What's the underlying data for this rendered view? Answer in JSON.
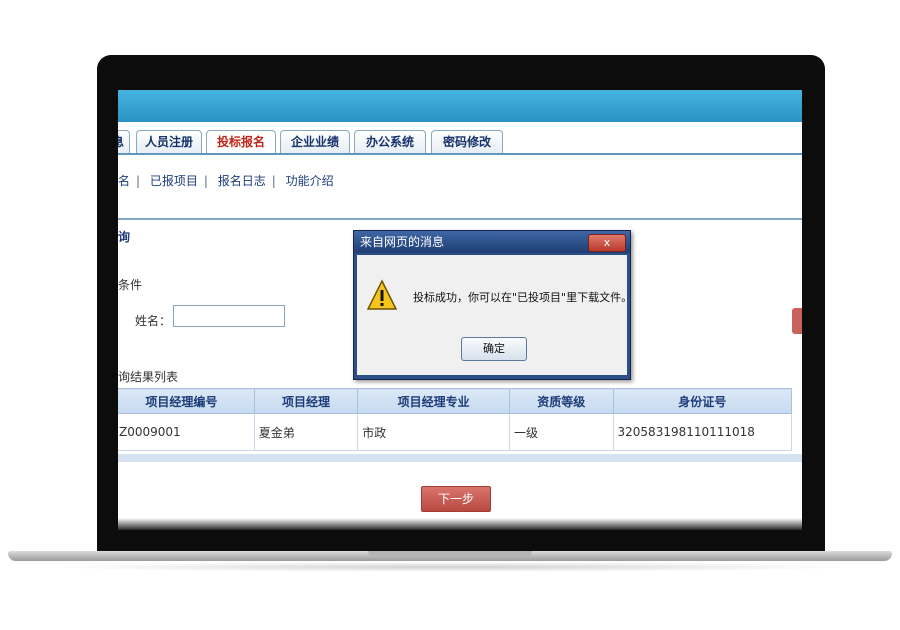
{
  "tabs": [
    "息",
    "人员注册",
    "投标报名",
    "企业业绩",
    "办公系统",
    "密码修改"
  ],
  "subnav": [
    "名",
    "已报项目",
    "报名日志",
    "功能介绍"
  ],
  "section_titles": {
    "top": "询",
    "filter": "条件",
    "result": "询结果列表"
  },
  "filter": {
    "name_label": "姓名：",
    "name_value": ""
  },
  "table": {
    "headers": [
      "项目经理编号",
      "项目经理",
      "项目经理专业",
      "资质等级",
      "身份证号"
    ],
    "rows": [
      [
        "Z0009001",
        "夏金弟",
        "市政",
        "一级",
        "320583198110111018"
      ]
    ]
  },
  "next_button": "下一步",
  "dialog": {
    "title": "来自网页的消息",
    "close": "x",
    "message": "投标成功，你可以在\"已投项目\"里下载文件。",
    "ok": "确定",
    "icon": "warning-icon"
  },
  "colors": {
    "topbar": "#2a93c6",
    "active_tab": "#c0261a",
    "next_button": "#b94a42",
    "dialog_title": "#1f3e72"
  }
}
